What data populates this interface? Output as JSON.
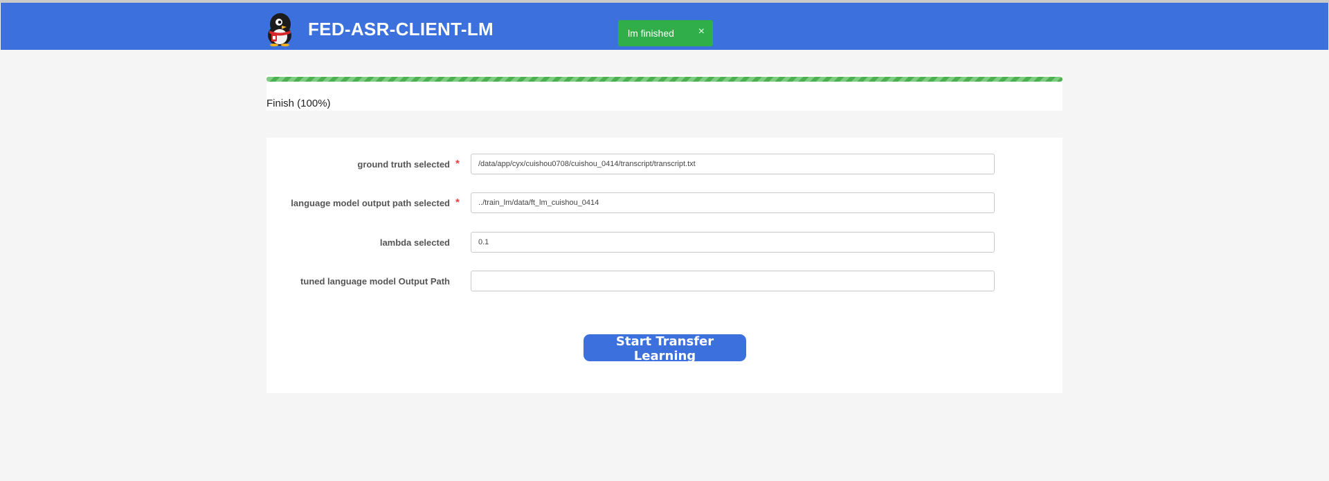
{
  "header": {
    "app_title": "FED-ASR-CLIENT-LM",
    "logo_icon": "penguin-logo-icon",
    "background_color": "#3c71dd"
  },
  "toast": {
    "message": "lm finished",
    "close_label": "×",
    "background_color": "#2fae4a"
  },
  "progress": {
    "percent": 100,
    "label": "Finish (100%)",
    "color": "#4caf50"
  },
  "form": {
    "fields": [
      {
        "label": "ground truth selected",
        "required": true,
        "value": "/data/app/cyx/cuishou0708/cuishou_0414/transcript/transcript.txt",
        "placeholder": ""
      },
      {
        "label": "language model output path selected",
        "required": true,
        "value": "../train_lm/data/ft_lm_cuishou_0414",
        "placeholder": ""
      },
      {
        "label": "lambda selected",
        "required": false,
        "value": "0.1",
        "placeholder": ""
      },
      {
        "label": "tuned language model Output Path",
        "required": false,
        "value": "",
        "placeholder": ""
      }
    ],
    "required_mark": "*",
    "submit_label": "Start Transfer Learning"
  }
}
